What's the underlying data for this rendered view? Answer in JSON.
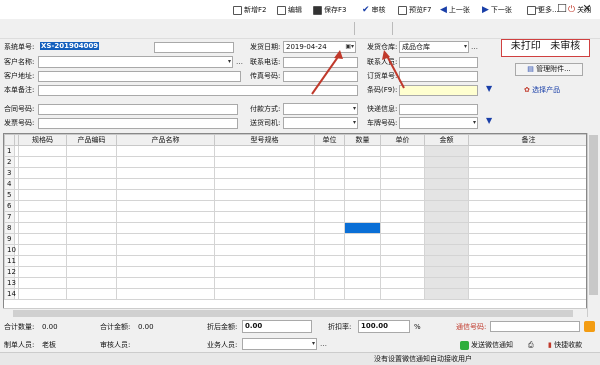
{
  "toolbar": {
    "new_label": "新增F2",
    "edit_label": "编辑",
    "save_label": "保存F3",
    "audit_label": "审核",
    "preview_label": "预览F7",
    "prev_label": "上一张",
    "next_label": "下一张",
    "more_label": "更多...",
    "close_label": "关闭"
  },
  "form": {
    "order_no_label": "系统单号:",
    "order_no_value": "XS-201904009",
    "delivery_date_label": "发货日期:",
    "delivery_date_value": "2019-04-24",
    "warehouse_label": "发货仓库:",
    "warehouse_value": "成品仓库",
    "customer_name_label": "客户名称:",
    "contact_phone_label": "联系电话:",
    "contact_person_label": "联系人员:",
    "customer_addr_label": "客户地址:",
    "fax_label": "传真号码:",
    "order_ref_label": "订货单号:",
    "remark_label": "本单备注:",
    "barcode_label": "条码(F9):",
    "select_product_label": "选择产品",
    "contract_no_label": "合同号码:",
    "payment_label": "付款方式:",
    "express_label": "快递信息:",
    "invoice_no_label": "发票号码:",
    "driver_label": "送货司机:",
    "car_no_label": "车牌号码:"
  },
  "status": {
    "print_status": "未打印",
    "audit_status": "未审核",
    "attachment_label": "管理附件..."
  },
  "table": {
    "headers": [
      "",
      "",
      "规格码",
      "产品编码",
      "产品名称",
      "型号规格",
      "单位",
      "数量",
      "单价",
      "金额",
      "备注"
    ],
    "row_numbers": [
      "1",
      "2",
      "3",
      "4",
      "5",
      "6",
      "7",
      "8",
      "9",
      "10",
      "11",
      "12",
      "13",
      "14"
    ]
  },
  "summary": {
    "total_qty_label": "合计数量:",
    "total_qty_value": "0.00",
    "total_amount_label": "合计金额:",
    "total_amount_value": "0.00",
    "discounted_label": "折后金额:",
    "discounted_value": "0.00",
    "discount_rate_label": "折扣率:",
    "discount_rate_value": "100.00",
    "percent": "%",
    "tracking_label": "通信号码:",
    "creator_label": "制单人员:",
    "creator_value": "老板",
    "auditor_label": "审核人员:",
    "sales_label": "业务人员:",
    "wechat_label": "发送微信通知",
    "receipt_label": "快捷收款",
    "footer_text": "没有设置微信通知自动接收用户"
  },
  "colors": {
    "accent": "#1a3fa8",
    "status_border": "#d04040",
    "selected_cell": "#0a6fd6",
    "arrow_red": "#c0392b"
  }
}
